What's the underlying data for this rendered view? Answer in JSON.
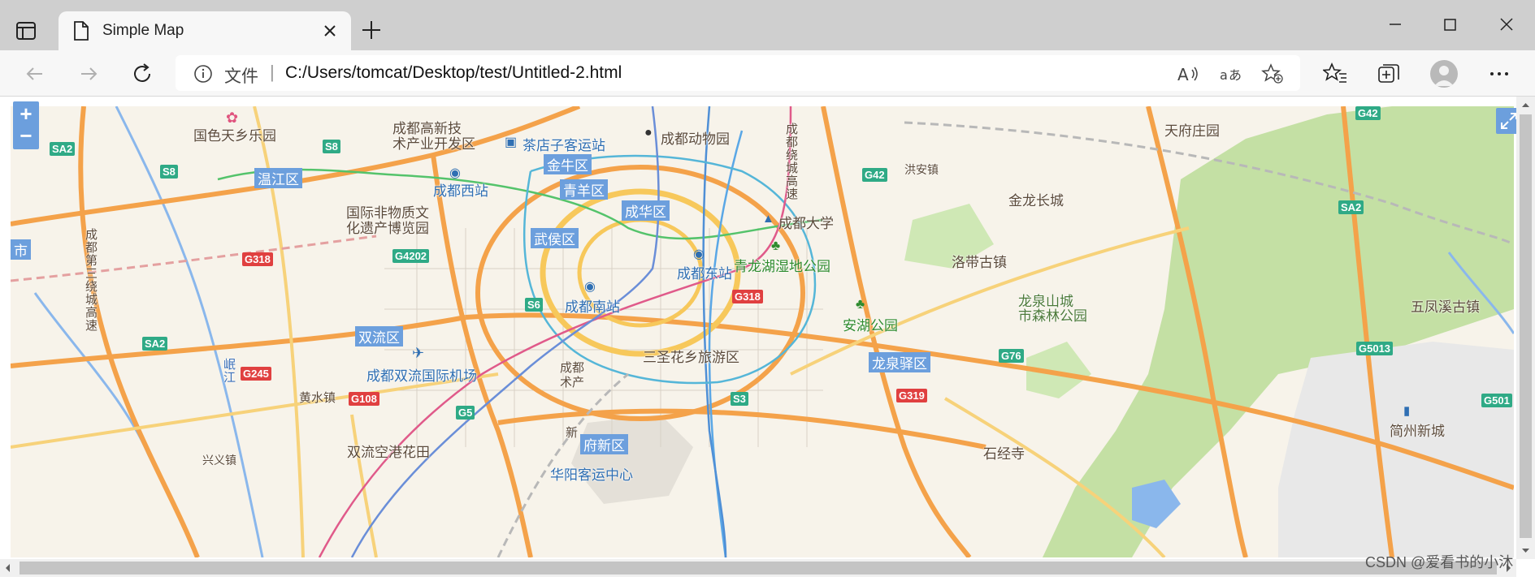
{
  "tab": {
    "title": "Simple Map"
  },
  "address_bar": {
    "security_label": "文件",
    "url": "C:/Users/tomcat/Desktop/test/Untitled-2.html"
  },
  "map": {
    "zoom_in": "+",
    "zoom_out": "−",
    "labels": {
      "guose": "国色天乡乐园",
      "gaoxin": "成都高新技\n术产业开发区",
      "chadianzi": "茶店子客运站",
      "zoo": "成都动物园",
      "tianfu": "天府庄园",
      "wenjiang": "温江区",
      "chengdu_west": "成都西站",
      "jinniu": "金牛区",
      "qingyang": "青羊区",
      "chenghua": "成华区",
      "wuhou": "武侯区",
      "feiyi": "国际非物质文\n化遗产博览园",
      "chengdu_east": "成都东站",
      "chengdu_uni": "成都大学",
      "qinglonghu": "青龙湖湿地公园",
      "jinlong": "金龙长城",
      "hongan": "洪安镇",
      "luodai": "洛带古镇",
      "chengdu_south": "成都南站",
      "shuangliu": "双流区",
      "airport": "成都双流国际机场",
      "sansheng": "三圣花乡旅游区",
      "anjing": "安湖公园",
      "longquan": "龙泉驿区",
      "longquanshan": "龙泉山城\n市森林公园",
      "wufeng": "五凤溪古镇",
      "huangshui": "黄水镇",
      "shuangliu_garden": "双流空港花田",
      "xinglong": "兴义镇",
      "shijingsi": "石经寺",
      "jianzhou": "简州新城",
      "tianfuxin": "府新区",
      "huayang": "华阳客运中心",
      "chengdu_outer": "成都第三绕城高速",
      "chengdu_ring": "成都绕城高速",
      "minjiang": "岷江",
      "shi": "市",
      "chengdu_center": "成都\n术产",
      "xin": "新"
    },
    "shields": {
      "sa2a": "SA2",
      "s8a": "S8",
      "s8b": "S8",
      "g318a": "G318",
      "g4202": "G4202",
      "s6": "S6",
      "sa2b": "SA2",
      "g245": "G245",
      "g108": "G108",
      "g5": "G5",
      "g318b": "G318",
      "s3": "S3",
      "g319": "G319",
      "g76": "G76",
      "g42a": "G42",
      "g42b": "G42",
      "sa2c": "SA2",
      "g5013": "G5013",
      "g501": "G501"
    }
  },
  "watermark": "CSDN @爱看书的小沐"
}
